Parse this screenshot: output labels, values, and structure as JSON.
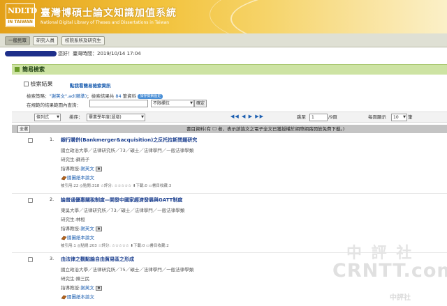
{
  "site": {
    "logo_top": "NDLTD",
    "logo_bottom": "IN TAIWAN",
    "title": "臺灣博碩士論文知識加值系統",
    "subtitle": "National Digital Library of Theses and Dissertations in Taiwan"
  },
  "nav": [
    "一般民眾",
    "研究人員",
    "校院系所及研究生"
  ],
  "welcome": {
    "text": "您好！臺灣時間：2019/10/14 17:04"
  },
  "panel": {
    "title": "簡易檢索"
  },
  "results": {
    "heading": "檢索結果",
    "simple_link": "點我看簡易檢索資訊",
    "strategy_label": "檢索策略：",
    "strategy_query": "\"謝芙文\".ad(精準)",
    "strategy_count_pre": "；檢索結果共",
    "strategy_count": "84",
    "strategy_count_post": "筆資料",
    "strategy_pill": "加存檢索歷史",
    "requery_label": "在規範的結果範圍內查詢：",
    "requery_select": "不限欄位",
    "requery_button": "確定"
  },
  "toolbar": {
    "view_select": "條列式",
    "sort_label": "排序：",
    "sort_select": "畢業學年度(遞增)",
    "pager": "◀◀ ◀ ▶ ▶▶",
    "goto_label": "跳至",
    "goto_value": "1",
    "total_pages": "/9頁",
    "per_page_label": "每頁顯示",
    "per_page_value": "10",
    "per_page_unit": "筆"
  },
  "column_header": {
    "select_all": "全選",
    "text": "書目資料(有 ☐ 者，表示該論文之電子全文已獲授權於網際網路開放免費下載。)"
  },
  "records": [
    {
      "num": "1.",
      "title": "銀行購併(Bankmerger&acquisition)之反托拉斯問題研究",
      "school": "國立政治大學／法律研究所／73／碩士／法律學門／一般法律學類",
      "student": "研究生:蘇燕子",
      "advisor_label": "指導教授:",
      "advisor": "謝芙文",
      "paper": "國圖紙本論文",
      "stats": "被引用:22 ◎點閱:318 ☆評分: ☆☆☆☆☆ ⬇下載:0 ▭書目收藏:3"
    },
    {
      "num": "2.",
      "title": "論普通優惠關稅制度—開發中國家經濟發展與GATT制度",
      "school": "東吳大學／法律研究所／73／碩士／法律學門／一般法律學類",
      "student": "研究生:林桓",
      "advisor_label": "指導教授:",
      "advisor": "謝芙文",
      "paper": "國圖紙本論文",
      "stats": "被引用:1 ◎點閱:203 ☆評分: ☆☆☆☆☆ ⬇下載:0 ▭書目收藏:2"
    },
    {
      "num": "3.",
      "title": "由法律之觀點論自由貿易區之形成",
      "school": "國立政治大學／法律研究所／75／碩士／法律學門／一般法律學類",
      "student": "研究生:陳三民",
      "advisor_label": "指導教授:",
      "advisor": "謝芙文",
      "paper": "國圖紙本論文",
      "stats": ""
    }
  ],
  "watermark": {
    "line1": "中 評 社",
    "line2": "CRNTT.com",
    "line3": "中評社"
  },
  "colors": {
    "banner": "#f2c23b",
    "panel_head": "#cde3a3",
    "link": "#1b5eb0",
    "welcome_mask": "#1e2f8a"
  }
}
